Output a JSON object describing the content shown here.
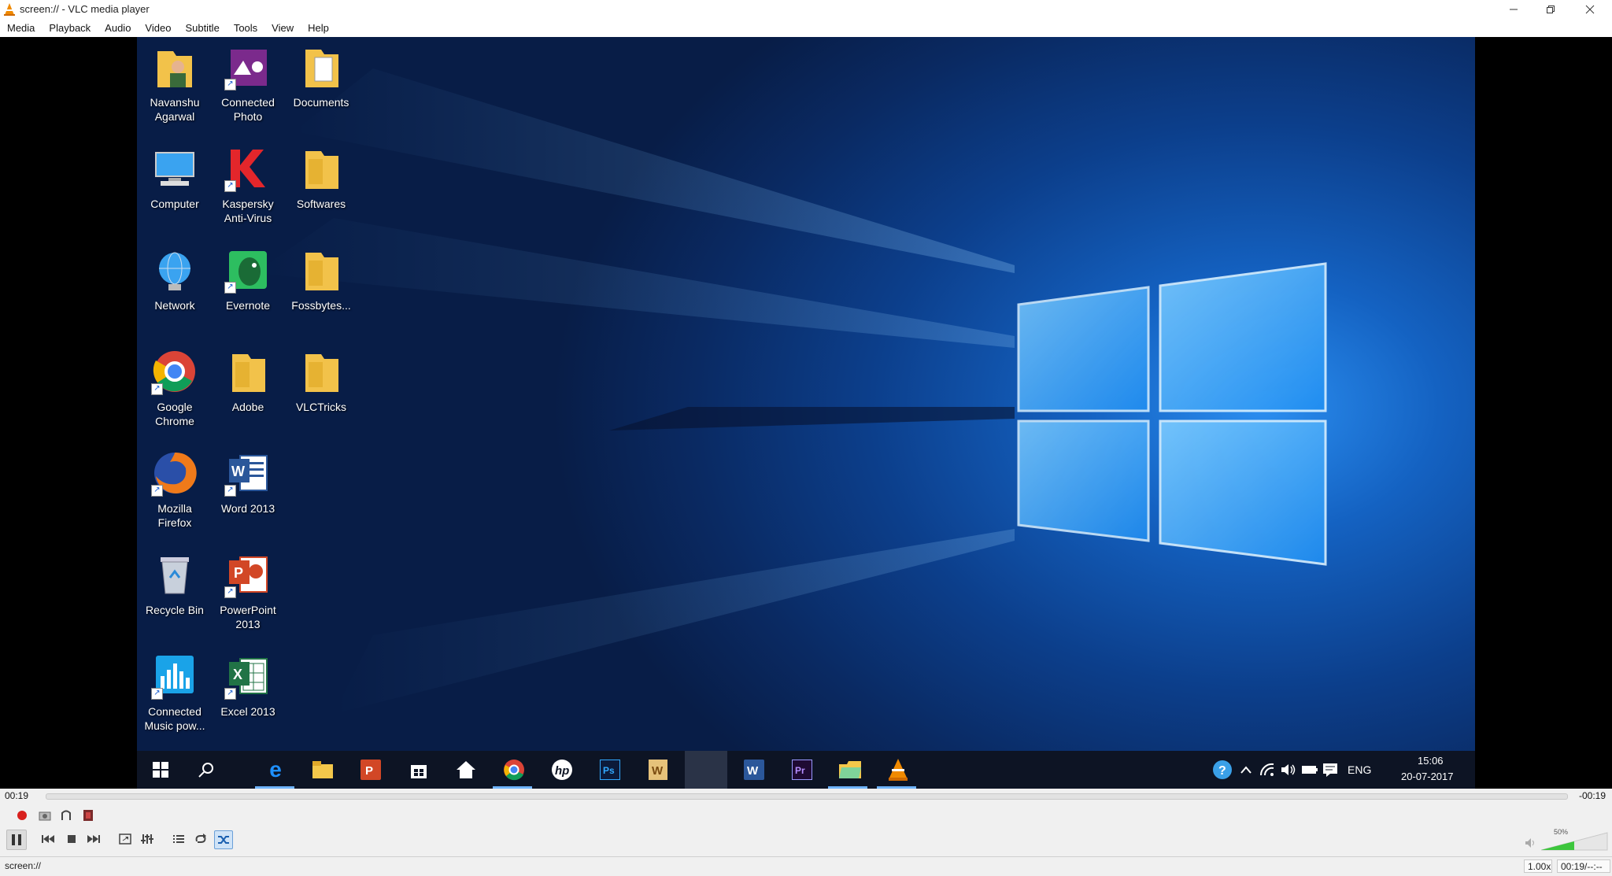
{
  "window": {
    "title": "screen:// - VLC media player"
  },
  "menu": [
    "Media",
    "Playback",
    "Audio",
    "Video",
    "Subtitle",
    "Tools",
    "View",
    "Help"
  ],
  "desktop_icons": [
    {
      "label": "Navanshu\nAgarwal",
      "icon": "user-folder-icon"
    },
    {
      "label": "Connected\nPhoto",
      "icon": "connected-photo-icon"
    },
    {
      "label": "Documents",
      "icon": "documents-folder-icon"
    },
    {
      "label": "Computer",
      "icon": "computer-icon"
    },
    {
      "label": "Kaspersky\nAnti-Virus",
      "icon": "kaspersky-icon"
    },
    {
      "label": "Softwares",
      "icon": "folder-icon"
    },
    {
      "label": "Network",
      "icon": "network-icon"
    },
    {
      "label": "Evernote",
      "icon": "evernote-icon"
    },
    {
      "label": "Fossbytes...",
      "icon": "folder-icon"
    },
    {
      "label": "Google\nChrome",
      "icon": "chrome-icon"
    },
    {
      "label": "Adobe",
      "icon": "folder-icon"
    },
    {
      "label": "VLCTricks",
      "icon": "folder-icon"
    },
    {
      "label": "Mozilla\nFirefox",
      "icon": "firefox-icon"
    },
    {
      "label": "Word 2013",
      "icon": "word-icon"
    },
    {
      "label": "Recycle Bin",
      "icon": "recycle-bin-icon"
    },
    {
      "label": "PowerPoint\n2013",
      "icon": "powerpoint-icon"
    },
    {
      "label": "Connected\nMusic pow...",
      "icon": "music-icon"
    },
    {
      "label": "Excel 2013",
      "icon": "excel-icon"
    }
  ],
  "taskbar": {
    "language": "ENG",
    "time": "15:06",
    "date": "20-07-2017",
    "apps": [
      "start-icon",
      "search-icon",
      "edge-icon",
      "file-explorer-icon",
      "powerpoint-icon",
      "store-icon",
      "home-icon",
      "chrome-icon",
      "hp-icon",
      "photoshop-icon",
      "word-alt-icon",
      "paint-icon",
      "word-icon",
      "premiere-icon",
      "folder-icon",
      "vlc-icon"
    ]
  },
  "playback": {
    "elapsed": "00:19",
    "remaining": "-00:19",
    "progress": 0.0
  },
  "volume": {
    "percent_label": "50%",
    "level": 0.5
  },
  "status": {
    "media": "screen://",
    "speed": "1.00x",
    "time": "00:19/--:--"
  },
  "colors": {
    "accent": "#1a7be0",
    "vlc_orange": "#f08a00",
    "volume_green": "#3cc63c"
  }
}
